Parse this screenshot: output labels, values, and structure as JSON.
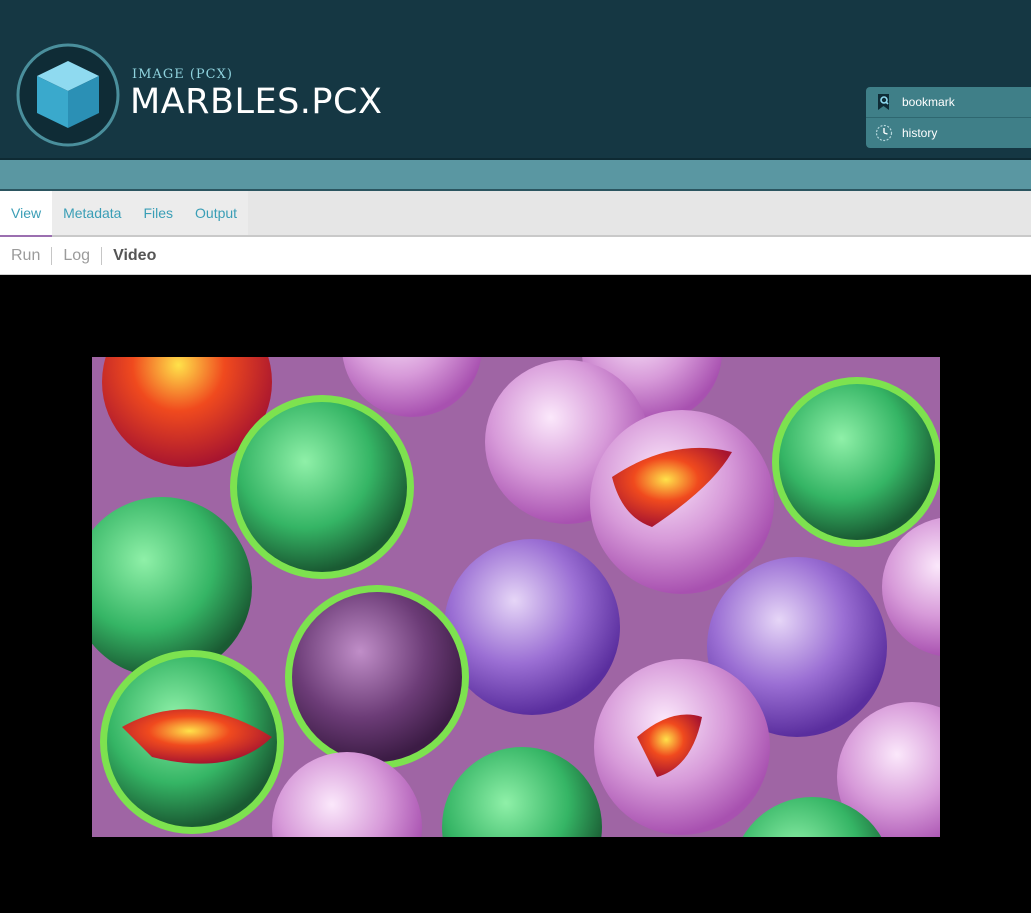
{
  "header": {
    "kind": "IMAGE (PCX)",
    "title": "MARBLES.PCX",
    "logo_icon": "cube-icon",
    "colors": {
      "background": "#153743",
      "accent": "#5a97a2"
    }
  },
  "side_panel": {
    "items": [
      {
        "label": "bookmark",
        "icon": "bookmark-icon"
      },
      {
        "label": "history",
        "icon": "clock-icon"
      }
    ]
  },
  "tabs": [
    {
      "label": "View",
      "active": true
    },
    {
      "label": "Metadata",
      "active": false
    },
    {
      "label": "Files",
      "active": false
    },
    {
      "label": "Output",
      "active": false
    }
  ],
  "subnav": [
    {
      "label": "Run",
      "active": false
    },
    {
      "label": "Log",
      "active": false
    },
    {
      "label": "Video",
      "active": true
    }
  ],
  "viewer": {
    "content": "video-frame"
  }
}
